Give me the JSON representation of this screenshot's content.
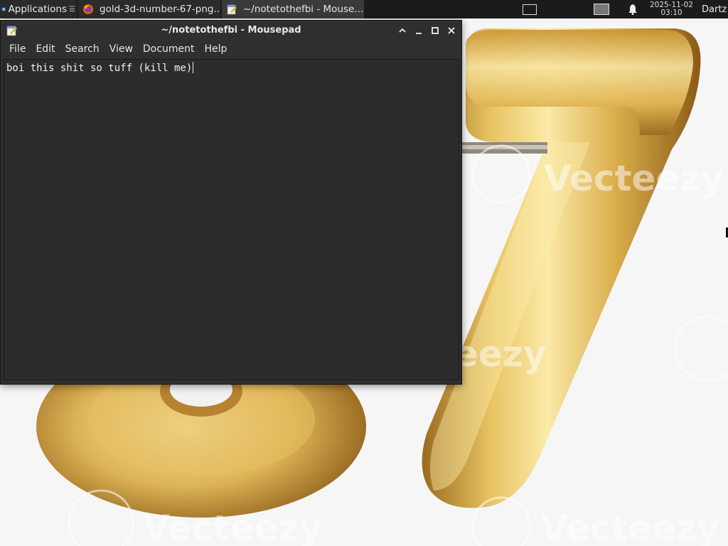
{
  "panel": {
    "apps_label": "Applications",
    "apps_arrow": "☰",
    "tasks": [
      {
        "label": "gold-3d-number-67-png..."
      },
      {
        "label": "~/notetothefbi - Mouse..."
      }
    ],
    "clock_date": "2025-11-02",
    "clock_time": "03:10",
    "username": "Dartz"
  },
  "wallpaper": {
    "number": "67",
    "watermark": "Vecteezy",
    "watermark_short": "teezy",
    "colors": {
      "gold_light": "#f4dc8a",
      "gold_mid": "#d4a84a",
      "gold_dark": "#8a5a18",
      "bg": "#f5f5f5"
    }
  },
  "window": {
    "title": "~/notetothefbi - Mousepad",
    "menus": [
      "File",
      "Edit",
      "Search",
      "View",
      "Document",
      "Help"
    ],
    "content": "boi this shit so tuff (kill me)"
  }
}
